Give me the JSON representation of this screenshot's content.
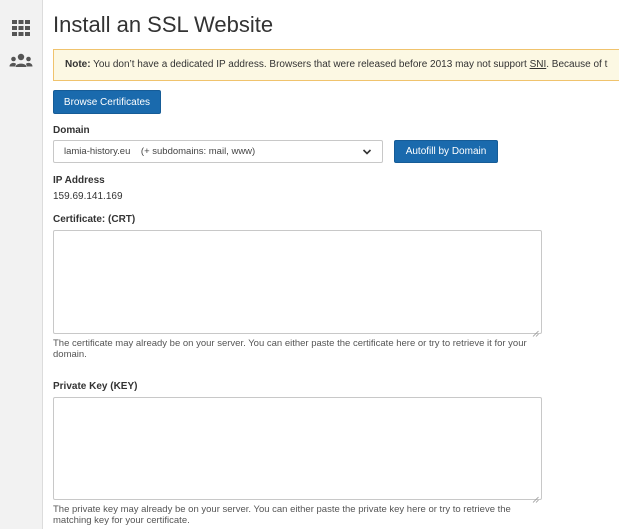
{
  "sidebar": {
    "items": [
      {
        "icon": "grid-icon"
      },
      {
        "icon": "users-icon"
      }
    ]
  },
  "page": {
    "title": "Install an SSL Website"
  },
  "note": {
    "label": "Note:",
    "text_before_sni": "You don’t have a dedicated IP address. Browsers that were released before 2013 may not support",
    "sni": "SNI",
    "text_after_sni": ". Because of t"
  },
  "browse_button": "Browse Certificates",
  "domain": {
    "label": "Domain",
    "selected": "lamia-history.eu    (+ subdomains: mail, www)",
    "autofill_button": "Autofill by Domain"
  },
  "ip": {
    "label": "IP Address",
    "value": "159.69.141.169"
  },
  "certificate": {
    "label": "Certificate: (CRT)",
    "value": "",
    "help": "The certificate may already be on your server. You can either paste the certificate here or try to retrieve it for your domain."
  },
  "private_key": {
    "label": "Private Key (KEY)",
    "value": "",
    "help": "The private key may already be on your server. You can either paste the private key here or try to retrieve the matching key for your certificate."
  }
}
